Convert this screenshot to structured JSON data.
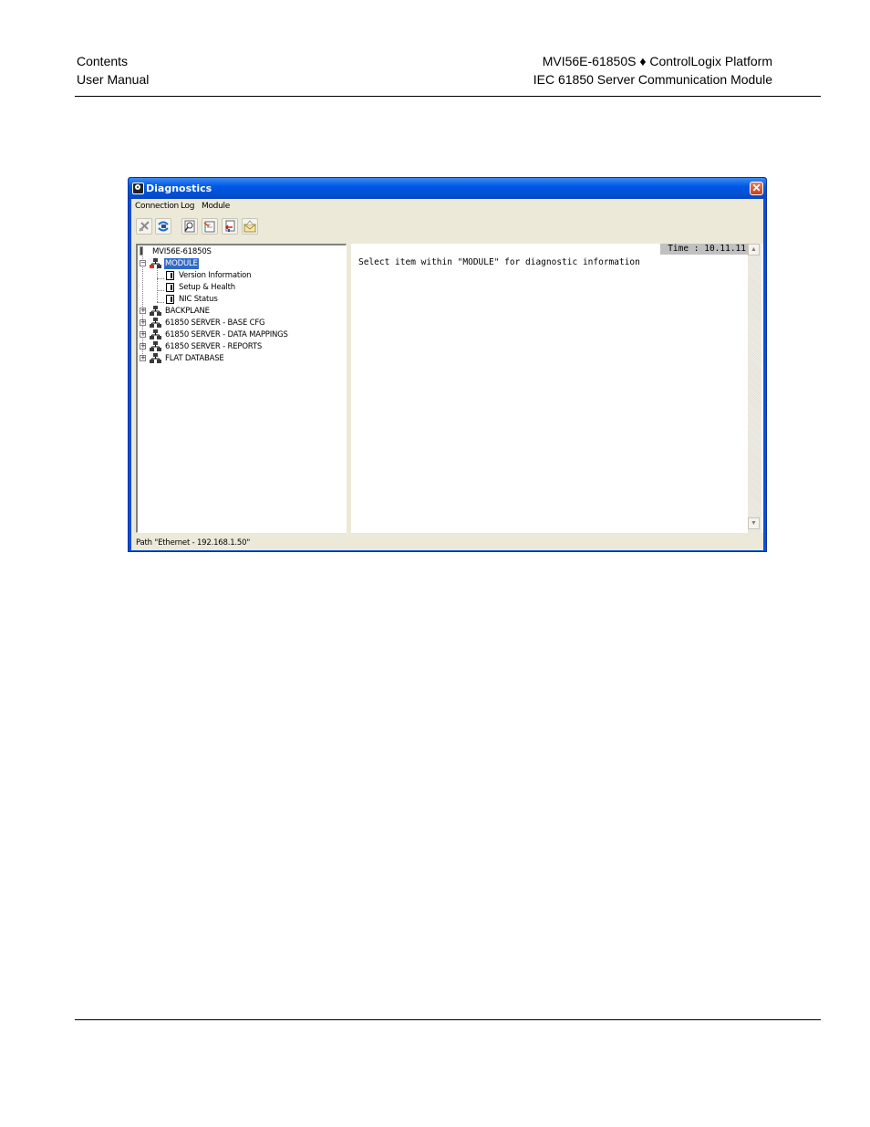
{
  "page_header": {
    "left_line1": "Contents",
    "left_line2": "User Manual",
    "right_line1": "MVI56E-61850S ♦ ControlLogix Platform",
    "right_line2": "IEC 61850 Server Communication Module"
  },
  "window": {
    "title": "Diagnostics",
    "close_glyph": "✕",
    "menu": [
      "Connection",
      "Log",
      "Module"
    ],
    "toolbar_icons": [
      "disconnect-icon",
      "connect-icon",
      "find-icon",
      "new-log-icon",
      "open-log-icon",
      "send-mail-icon"
    ],
    "tree": {
      "root": "MVI56E-61850S",
      "module": {
        "label": "MODULE",
        "expander": "−",
        "children": [
          "Version Information",
          "Setup & Health",
          "NIC Status"
        ]
      },
      "nodes": [
        {
          "label": "BACKPLANE",
          "expander": "+"
        },
        {
          "label": "61850 SERVER - BASE CFG",
          "expander": "+"
        },
        {
          "label": "61850 SERVER - DATA MAPPINGS",
          "expander": "+"
        },
        {
          "label": "61850 SERVER - REPORTS",
          "expander": "+"
        },
        {
          "label": "FLAT DATABASE",
          "expander": "+"
        }
      ]
    },
    "output": {
      "time": "Time : 10.11.11",
      "message": "Select item within \"MODULE\" for diagnostic information"
    },
    "status": "Path \"Ethernet - 192.168.1.50\""
  }
}
